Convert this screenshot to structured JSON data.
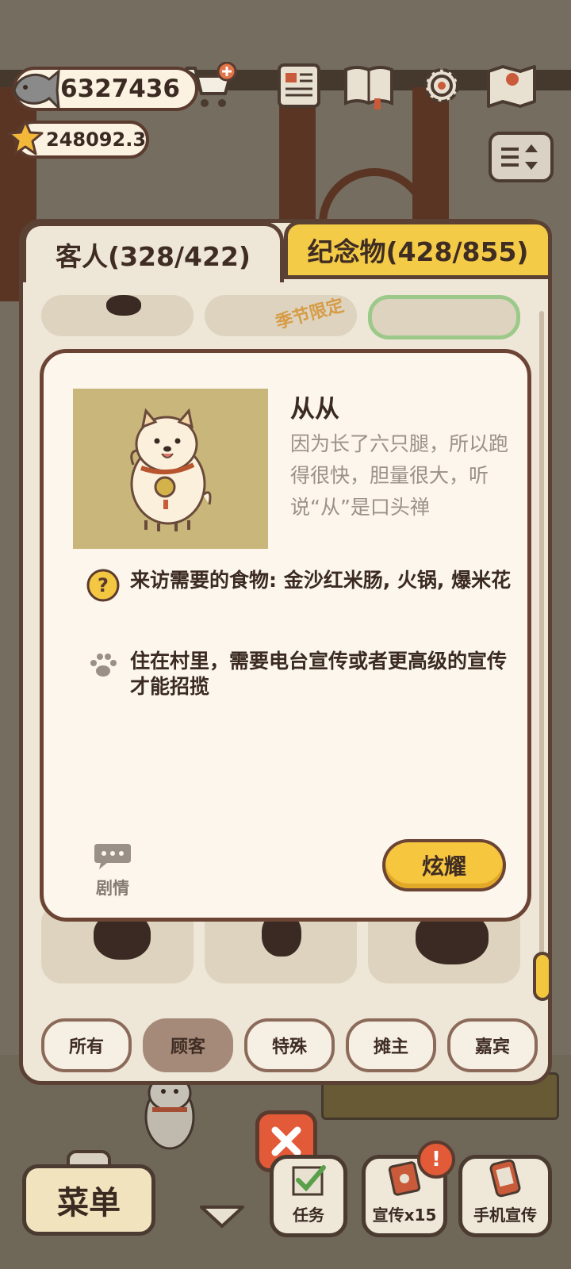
{
  "currency": {
    "fish": "6327436",
    "stars": "248092.3"
  },
  "tabs": {
    "guests": "客人(328/422)",
    "souvenirs": "纪念物(428/855)"
  },
  "grid": {
    "season_tag": "季节限定"
  },
  "detail": {
    "name": "从从",
    "description": "因为长了六只腿，所以跑得很快，胆量很大，听说“从”是口头禅",
    "food_requirement": "来访需要的食物: 金沙红米肠, 火锅, 爆米花",
    "residence": "住在村里，需要电台宣传或者更高级的宣传才能招揽",
    "story_label": "剧情",
    "show_off_button": "炫耀"
  },
  "filters": [
    {
      "label": "所有",
      "active": false
    },
    {
      "label": "顾客",
      "active": true
    },
    {
      "label": "特殊",
      "active": false
    },
    {
      "label": "摊主",
      "active": false
    },
    {
      "label": "嘉宾",
      "active": false
    }
  ],
  "bottom": {
    "menu": "菜单",
    "tasks": "任务",
    "promotion": "宣传x15",
    "promotion_badge": "!",
    "phone_promotion": "手机宣传"
  },
  "colors": {
    "accent_yellow": "#f6c63f",
    "close_red": "#e25a38",
    "outline_brown": "#5a4133",
    "panel_cream": "#fcf6ec"
  }
}
